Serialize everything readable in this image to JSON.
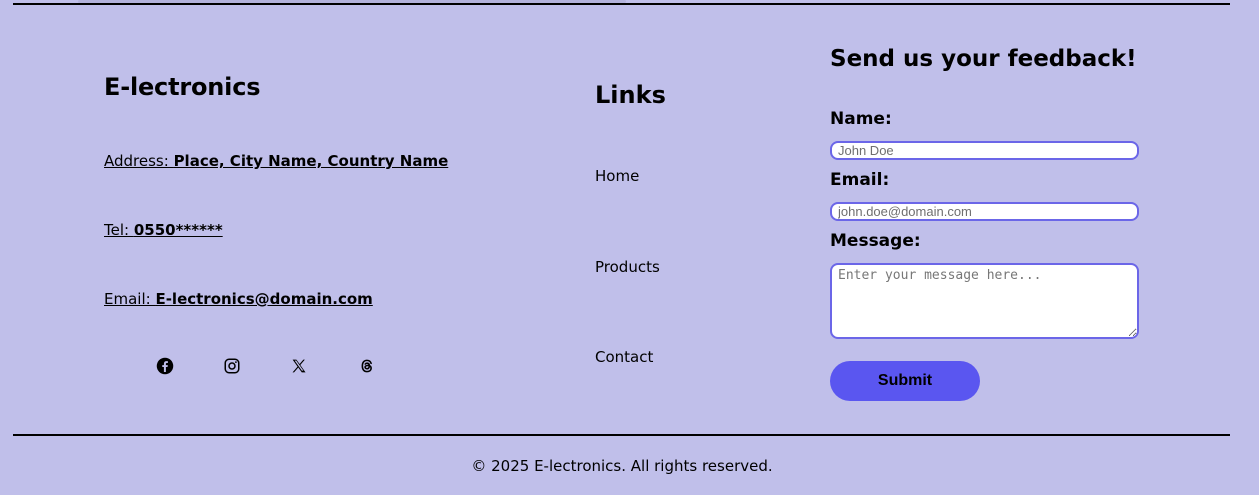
{
  "company": {
    "name": "E-lectronics",
    "address_label": "Address: ",
    "address_value": "Place, City Name, Country Name",
    "tel_label": "Tel: ",
    "tel_value": "0550******",
    "email_label": "Email: ",
    "email_value": "E-lectronics@domain.com"
  },
  "social": [
    {
      "icon": "facebook-icon"
    },
    {
      "icon": "instagram-icon"
    },
    {
      "icon": "x-icon"
    },
    {
      "icon": "threads-icon"
    }
  ],
  "links": {
    "title": "Links",
    "items": [
      {
        "label": "Home"
      },
      {
        "label": "Products"
      },
      {
        "label": "Contact"
      }
    ]
  },
  "feedback": {
    "title": "Send us your feedback!",
    "name_label": "Name:",
    "name_placeholder": "John Doe",
    "name_value": "",
    "email_label": "Email:",
    "email_placeholder": "john.doe@domain.com",
    "email_value": "",
    "message_label": "Message:",
    "message_placeholder": "Enter your message here...",
    "message_value": "",
    "submit_label": "Submit"
  },
  "footer": {
    "copyright": "© 2025 E-lectronics. All rights reserved."
  },
  "colors": {
    "background": "#c0bfea",
    "accent": "#5a56f0",
    "input_border": "#6b66e8"
  }
}
